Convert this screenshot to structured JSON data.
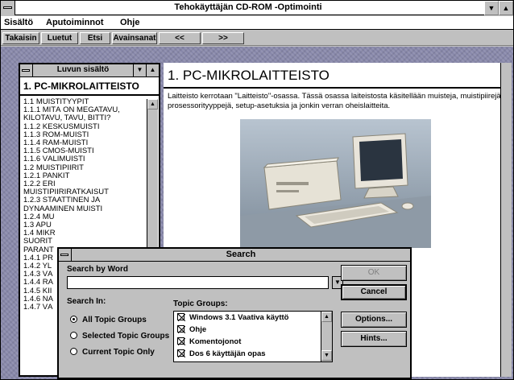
{
  "window": {
    "title": "Tehokäyttäjän CD-ROM -Optimointi",
    "sys_menu_icon": "dash-icon",
    "minimize_glyph": "▼",
    "maximize_glyph": "▲"
  },
  "menubar": {
    "items": [
      "Sisältö",
      "Aputoiminnot",
      "Ohje"
    ]
  },
  "toolbar": {
    "buttons": [
      "Takaisin",
      "Luetut",
      "Etsi",
      "Avainsanat",
      "<<",
      ">>"
    ]
  },
  "left_panel": {
    "title": "Luvun sisältö",
    "heading": "1. PC-MIKROLAITTEISTO",
    "items": [
      "1.1 MUISTITYYPIT",
      "1.1.1 MITÄ ON MEGATAVU,",
      "KILOTAVU, TAVU, BITTI?",
      "1.1.2 KESKUSMUISTI",
      "1.1.3 ROM-MUISTI",
      "1.1.4 RAM-MUISTI",
      "1.1.5 CMOS-MUISTI",
      "1.1.6 VÄLIMUISTI",
      "1.2 MUISTIPIIRIT",
      "1.2.1 PANKIT",
      "1.2.2 ERI",
      "MUISTIPIIRIRATKAISUT",
      "1.2.3 STAATTINEN JA",
      "DYNAAMINEN MUISTI",
      "1.2.4 MU",
      "1.3 APU",
      "1.4 MIKR",
      "SUORIT",
      "PARANT",
      "1.4.1 PR",
      "1.4.2 YL",
      "1.4.3 VÄ",
      "1.4.4 RA",
      "1.4.5 KII",
      "1.4.6 NA",
      "1.4.7 VÄ"
    ]
  },
  "right_panel": {
    "heading": "1. PC-MIKROLAITTEISTO",
    "body": "Laitteisto kerrotaan \"Laitteisto\"-osassa. Tässä osassa laiteistosta käsitellään muisteja, muistipiirejä, prosessorityyppejä, setup-asetuksia ja jonkin verran oheislaitteita."
  },
  "search_dialog": {
    "title": "Search",
    "search_by_word_label": "Search by Word",
    "search_value": "",
    "search_in_label": "Search In:",
    "radio_options": [
      {
        "label": "All Topic Groups",
        "selected": true
      },
      {
        "label": "Selected Topic Groups",
        "selected": false
      },
      {
        "label": "Current Topic Only",
        "selected": false
      }
    ],
    "topic_groups_label": "Topic Groups:",
    "topic_groups": [
      {
        "label": "Windows 3.1 Vaativa käyttö",
        "checked": true
      },
      {
        "label": "Ohje",
        "checked": true
      },
      {
        "label": "Komentojonot",
        "checked": true
      },
      {
        "label": "Dos 6 käyttäjän opas",
        "checked": true
      }
    ],
    "buttons": {
      "ok": "OK",
      "cancel": "Cancel",
      "options": "Options...",
      "hints": "Hints..."
    }
  },
  "colors": {
    "workspace": "#8888aa",
    "chrome": "#c0c0c0"
  }
}
